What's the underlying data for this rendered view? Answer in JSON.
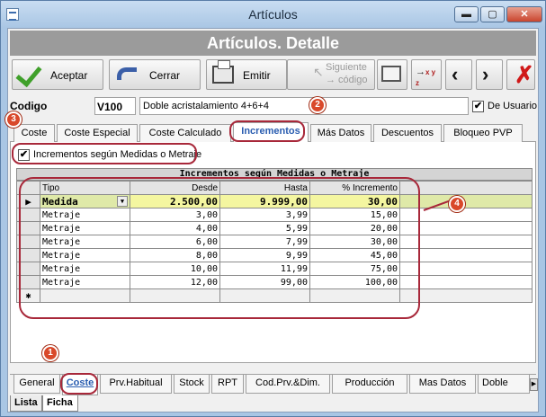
{
  "window": {
    "title": "Artículos"
  },
  "header": {
    "title": "Artículos. Detalle"
  },
  "toolbar": {
    "accept": "Aceptar",
    "close": "Cerrar",
    "print": "Emitir",
    "next_line1": "Siguiente",
    "next_line2": "→ código"
  },
  "article": {
    "code_label": "Codigo",
    "code": "V100",
    "description": "Doble acristalamiento 4+6+4",
    "user_label": "De Usuario"
  },
  "tabs_top": [
    "Coste",
    "Coste Especial",
    "Coste Calculado",
    "Incrementos",
    "Más Datos",
    "Descuentos",
    "Bloqueo PVP"
  ],
  "panel": {
    "checkbox_label": "Incrementos según Medidas o Metraje",
    "grid_title": "Incrementos según Medidas o Metraje",
    "columns": [
      "Tipo",
      "Desde",
      "Hasta",
      "% Incremento"
    ],
    "rows": [
      [
        "Medida",
        "2.500,00",
        "9.999,00",
        "30,00"
      ],
      [
        "Metraje",
        "3,00",
        "3,99",
        "15,00"
      ],
      [
        "Metraje",
        "4,00",
        "5,99",
        "20,00"
      ],
      [
        "Metraje",
        "6,00",
        "7,99",
        "30,00"
      ],
      [
        "Metraje",
        "8,00",
        "9,99",
        "45,00"
      ],
      [
        "Metraje",
        "10,00",
        "11,99",
        "75,00"
      ],
      [
        "Metraje",
        "12,00",
        "99,00",
        "100,00"
      ]
    ],
    "new_row_marker": "✱"
  },
  "tabs_bottom": [
    "General",
    "Coste",
    "Prv.Habitual",
    "Stock",
    "RPT",
    "Cod.Prv.&Dim.",
    "Producción",
    "Mas Datos",
    "Doble Acrist"
  ],
  "footer_tabs": [
    "Lista",
    "Ficha"
  ],
  "markers": [
    "1",
    "2",
    "3",
    "4"
  ],
  "colors": {
    "accent": "#2a5db0",
    "annotation": "#d9482a",
    "header_band": "#9b9b9b",
    "selected_row": "#dfe9a8"
  }
}
